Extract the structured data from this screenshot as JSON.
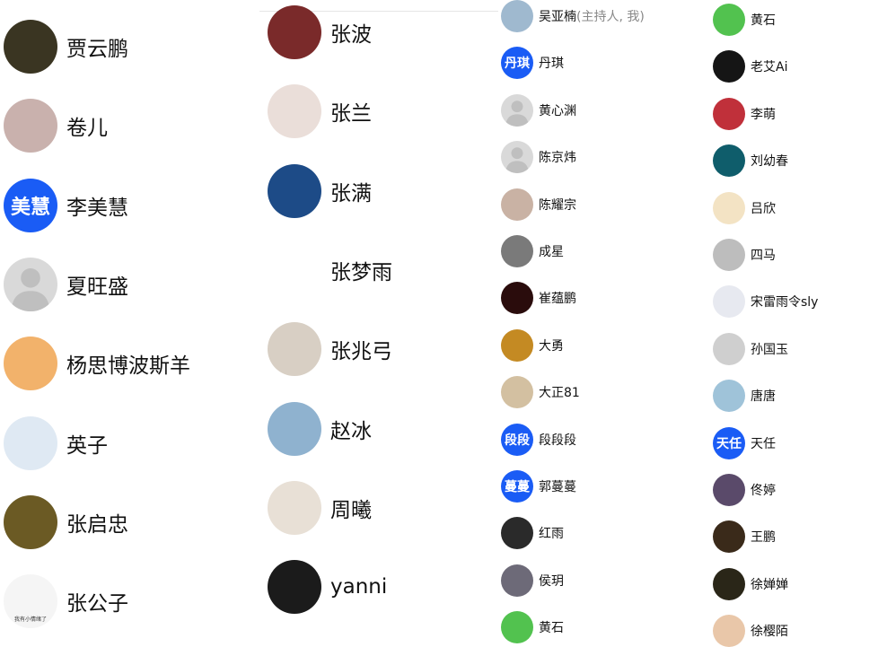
{
  "colors": {
    "accent_blue": "#1a5cf5",
    "placeholder_gray": "#d9d9d9",
    "host_gray": "#888888"
  },
  "col1": [
    {
      "name": "贾云鹏",
      "avatar": {
        "type": "photo",
        "icon": "basketball-player-photo",
        "bg": "#3a3522"
      }
    },
    {
      "name": "卷儿",
      "avatar": {
        "type": "photo",
        "icon": "blurred-portrait-photo",
        "bg": "#c9b1ad"
      }
    },
    {
      "name": "李美慧",
      "avatar": {
        "type": "text",
        "text": "美慧",
        "bg": "#1a5cf5"
      }
    },
    {
      "name": "夏旺盛",
      "avatar": {
        "type": "placeholder",
        "icon": "default-person-icon",
        "bg": "#d9d9d9"
      }
    },
    {
      "name": "杨思博波斯羊",
      "avatar": {
        "type": "photo",
        "icon": "cartoon-cat-hat-photo",
        "bg": "#f2b26b"
      }
    },
    {
      "name": "英子",
      "avatar": {
        "type": "photo",
        "icon": "anime-girl-photo",
        "bg": "#dfe9f3"
      }
    },
    {
      "name": "张启忠",
      "avatar": {
        "type": "photo",
        "icon": "forest-path-photo",
        "bg": "#6b5a24"
      }
    },
    {
      "name": "张公子",
      "avatar": {
        "type": "photo",
        "icon": "meme-cat-sketch-photo",
        "bg": "#f5f5f5",
        "caption": "我有小情绪了"
      }
    }
  ],
  "col2": [
    {
      "name": "张波",
      "avatar": {
        "type": "photo",
        "icon": "woman-green-dress-photo",
        "bg": "#7a2a2a"
      }
    },
    {
      "name": "张兰",
      "avatar": {
        "type": "photo",
        "icon": "woman-glasses-photo",
        "bg": "#eaded9"
      }
    },
    {
      "name": "张满",
      "avatar": {
        "type": "photo",
        "icon": "planet-space-photo",
        "bg": "#1d4b87"
      }
    },
    {
      "name": "张梦雨",
      "avatar": {
        "type": "photo",
        "icon": "cartoon-morty-photo",
        "bg": "#ffffff"
      }
    },
    {
      "name": "张兆弓",
      "avatar": {
        "type": "photo",
        "icon": "sculpture-art-photo",
        "bg": "#d8cfc4"
      }
    },
    {
      "name": "赵冰",
      "avatar": {
        "type": "photo",
        "icon": "beach-couple-photo",
        "bg": "#8fb2cf"
      }
    },
    {
      "name": "周曦",
      "avatar": {
        "type": "photo",
        "icon": "woman-red-dress-photo",
        "bg": "#e8e0d6"
      }
    },
    {
      "name": "yanni",
      "avatar": {
        "type": "photo",
        "icon": "dark-eyes-art-photo",
        "bg": "#1b1b1b"
      }
    }
  ],
  "col3": [
    {
      "name": "吴亚楠",
      "host": "(主持人, 我)",
      "avatar": {
        "type": "photo",
        "icon": "map-illustration-photo",
        "bg": "#9fb9cf"
      }
    },
    {
      "name": "丹琪",
      "avatar": {
        "type": "text",
        "text": "丹琪",
        "bg": "#1a5cf5"
      }
    },
    {
      "name": "黄心渊",
      "avatar": {
        "type": "placeholder",
        "icon": "default-person-icon",
        "bg": "#d9d9d9"
      }
    },
    {
      "name": "陈京炜",
      "avatar": {
        "type": "placeholder",
        "icon": "default-person-icon",
        "bg": "#d9d9d9"
      }
    },
    {
      "name": "陈耀宗",
      "avatar": {
        "type": "photo",
        "icon": "man-portrait-photo",
        "bg": "#c9b2a4"
      }
    },
    {
      "name": "成星",
      "avatar": {
        "type": "photo",
        "icon": "vintage-bw-photo",
        "bg": "#7a7a7a"
      }
    },
    {
      "name": "崔蕴鹏",
      "avatar": {
        "type": "photo",
        "icon": "red-dark-pattern-photo",
        "bg": "#2a0c0c"
      }
    },
    {
      "name": "大勇",
      "avatar": {
        "type": "photo",
        "icon": "golden-silhouette-photo",
        "bg": "#c48a23"
      }
    },
    {
      "name": "大正81",
      "avatar": {
        "type": "photo",
        "icon": "beach-horizon-photo",
        "bg": "#d3c0a1"
      }
    },
    {
      "name": "段段段",
      "avatar": {
        "type": "text",
        "text": "段段",
        "bg": "#1a5cf5"
      }
    },
    {
      "name": "郭蔓蔓",
      "avatar": {
        "type": "text",
        "text": "蔓蔓",
        "bg": "#1a5cf5"
      }
    },
    {
      "name": "红雨",
      "avatar": {
        "type": "photo",
        "icon": "white-cat-dark-photo",
        "bg": "#2a2a2a"
      }
    },
    {
      "name": "侯玥",
      "avatar": {
        "type": "photo",
        "icon": "sunset-rider-photo",
        "bg": "#6d6a78"
      }
    },
    {
      "name": "黄石",
      "avatar": {
        "type": "photo",
        "icon": "cartoon-face-photo",
        "bg": "#52c24f"
      }
    }
  ],
  "col4": [
    {
      "name": "黄石",
      "avatar": {
        "type": "photo",
        "icon": "cartoon-face-photo",
        "bg": "#52c24f"
      }
    },
    {
      "name": "老艾Ai",
      "avatar": {
        "type": "photo",
        "icon": "cat-eye-photo",
        "bg": "#151515"
      }
    },
    {
      "name": "李萌",
      "avatar": {
        "type": "photo",
        "icon": "cartoon-girl-red-photo",
        "bg": "#c0303a"
      }
    },
    {
      "name": "刘幼春",
      "avatar": {
        "type": "photo",
        "icon": "hat-man-teal-photo",
        "bg": "#0f5d6b"
      }
    },
    {
      "name": "吕欣",
      "avatar": {
        "type": "photo",
        "icon": "cartoon-character-photo",
        "bg": "#f3e3c4"
      }
    },
    {
      "name": "四马",
      "avatar": {
        "type": "photo",
        "icon": "snowy-trees-photo",
        "bg": "#bdbdbd"
      }
    },
    {
      "name": "宋雷雨令sly",
      "avatar": {
        "type": "photo",
        "icon": "white-feather-photo",
        "bg": "#e7e9f0"
      }
    },
    {
      "name": "孙国玉",
      "avatar": {
        "type": "photo",
        "icon": "sketch-portrait-photo",
        "bg": "#cfcfcf"
      }
    },
    {
      "name": "唐唐",
      "avatar": {
        "type": "photo",
        "icon": "beach-child-photo",
        "bg": "#9fc3d9"
      }
    },
    {
      "name": "天任",
      "avatar": {
        "type": "text",
        "text": "天任",
        "bg": "#1a5cf5"
      }
    },
    {
      "name": "佟婷",
      "avatar": {
        "type": "photo",
        "icon": "woman-portrait-photo",
        "bg": "#5a4a6a"
      }
    },
    {
      "name": "王鹏",
      "avatar": {
        "type": "photo",
        "icon": "colorful-art-photo",
        "bg": "#3a2a1a"
      }
    },
    {
      "name": "徐婵婵",
      "avatar": {
        "type": "photo",
        "icon": "dark-branch-photo",
        "bg": "#2a2618"
      }
    },
    {
      "name": "徐樱陌",
      "avatar": {
        "type": "photo",
        "icon": "flower-portrait-photo",
        "bg": "#e9c7a9"
      }
    }
  ]
}
